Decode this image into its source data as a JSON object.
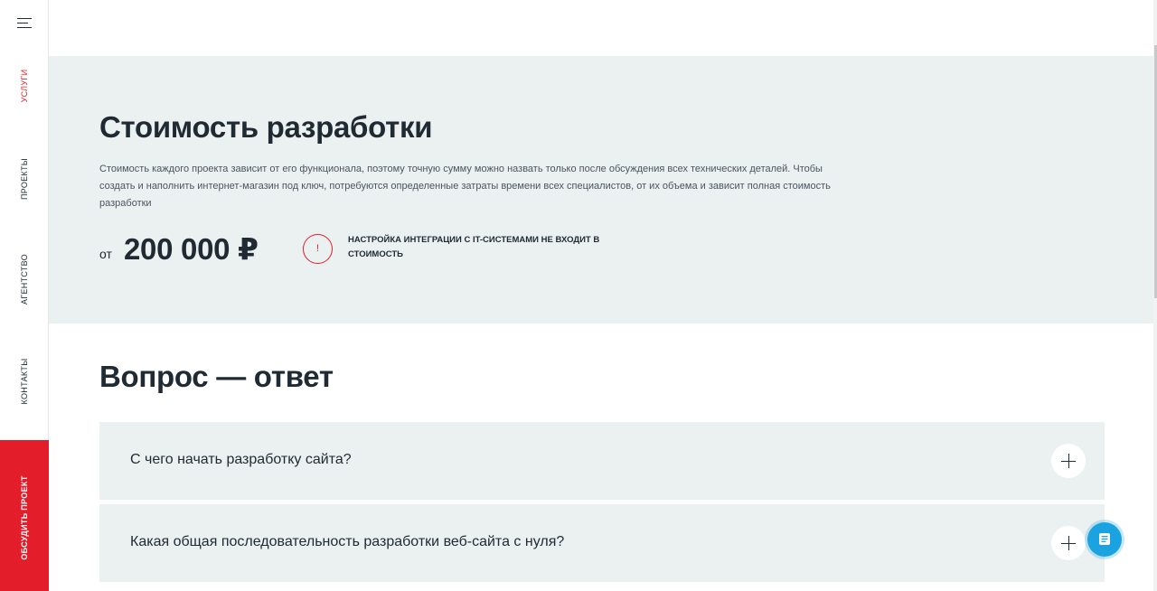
{
  "sidebar": {
    "nav": [
      {
        "label": "Услуги",
        "active": true
      },
      {
        "label": "Проекты",
        "active": false
      },
      {
        "label": "Агентство",
        "active": false
      },
      {
        "label": "Контакты",
        "active": false
      }
    ],
    "cta_label": "Обсудить проект",
    "menu_icon": "hamburger-menu-icon"
  },
  "pricing": {
    "title": "Стоимость разработки",
    "description": "Стоимость каждого проекта зависит от его функционала, поэтому точную сумму можно назвать только после обсуждения всех технических деталей. Чтобы создать и наполнить интернет-магазин под ключ, потребуются определенные затраты времени всех специалистов, от их объема и зависит полная стоимость разработки",
    "from_label": "от",
    "price": "200 000 ₽",
    "warning_icon_glyph": "!",
    "warning_text": "Настройка интеграции с IT-системами не входит в стоимость"
  },
  "faq": {
    "title": "Вопрос — ответ",
    "items": [
      {
        "question": "С чего начать разработку сайта?"
      },
      {
        "question": "Какая общая последовательность разработки веб-сайта с нуля?"
      }
    ]
  },
  "colors": {
    "accent": "#e31e2a",
    "section_bg": "#ebf0f0",
    "chat": "#1aa3e0",
    "text": "#1f2a33"
  }
}
